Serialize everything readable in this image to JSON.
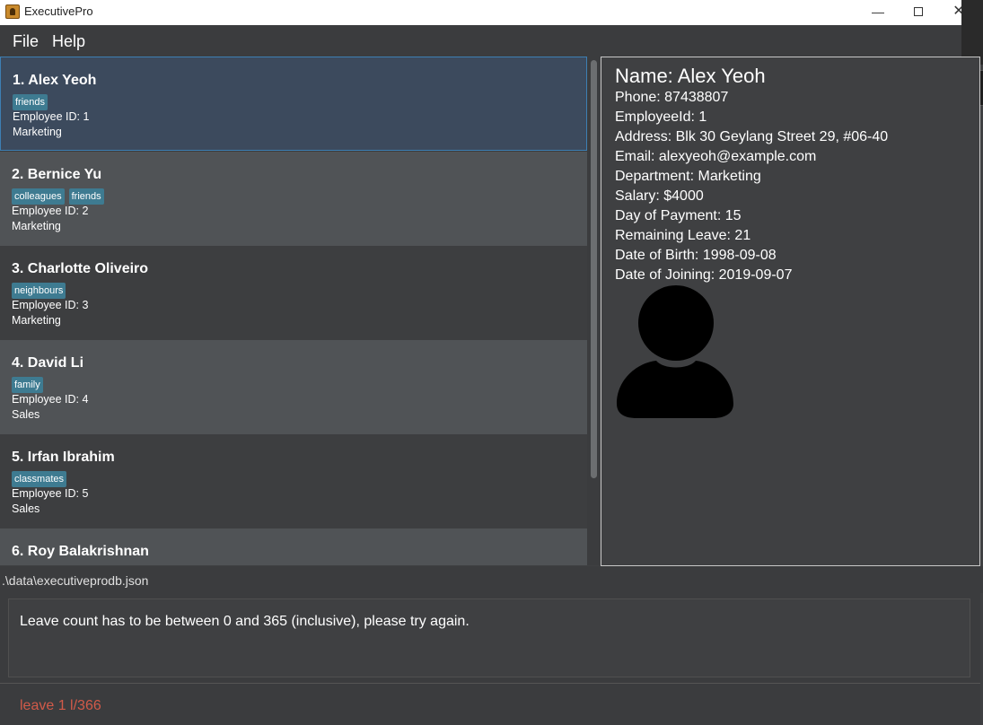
{
  "window": {
    "title": "ExecutivePro",
    "minimize_glyph": "—",
    "close_glyph": "✕"
  },
  "menu": {
    "items": [
      {
        "label": "File"
      },
      {
        "label": "Help"
      }
    ]
  },
  "employees": [
    {
      "name": "1.  Alex Yeoh",
      "tags": [
        "friends"
      ],
      "id_text": "Employee ID: 1",
      "department": "Marketing",
      "selected": true
    },
    {
      "name": "2.  Bernice Yu",
      "tags": [
        "colleagues",
        "friends"
      ],
      "id_text": "Employee ID: 2",
      "department": "Marketing"
    },
    {
      "name": "3.  Charlotte Oliveiro",
      "tags": [
        "neighbours"
      ],
      "id_text": "Employee ID: 3",
      "department": "Marketing"
    },
    {
      "name": "4.  David Li",
      "tags": [
        "family"
      ],
      "id_text": "Employee ID: 4",
      "department": "Sales"
    },
    {
      "name": "5.  Irfan Ibrahim",
      "tags": [
        "classmates"
      ],
      "id_text": "Employee ID: 5",
      "department": "Sales"
    },
    {
      "name": "6.  Roy Balakrishnan",
      "tags": [],
      "id_text": "",
      "department": ""
    }
  ],
  "detail": {
    "name": "Name: Alex Yeoh",
    "lines": [
      "Phone: 87438807",
      "EmployeeId: 1",
      "Address: Blk 30 Geylang Street 29, #06-40",
      "Email: alexyeoh@example.com",
      "Department: Marketing",
      "Salary: $4000",
      "Day of Payment: 15",
      "Remaining Leave: 21",
      "Date of Birth: 1998-09-08",
      "Date of Joining: 2019-09-07"
    ],
    "avatar_icon": "person-silhouette-icon"
  },
  "status": {
    "file_path": ".\\data\\executiveprodb.json"
  },
  "result": {
    "message": "Leave count has to be between 0 and 365 (inclusive), please try again."
  },
  "command": {
    "value": "leave 1 l/366"
  },
  "colors": {
    "tag_bg": "#3e7b91",
    "selected_border": "#3d7fb3",
    "command_error_text": "#d25a49"
  }
}
